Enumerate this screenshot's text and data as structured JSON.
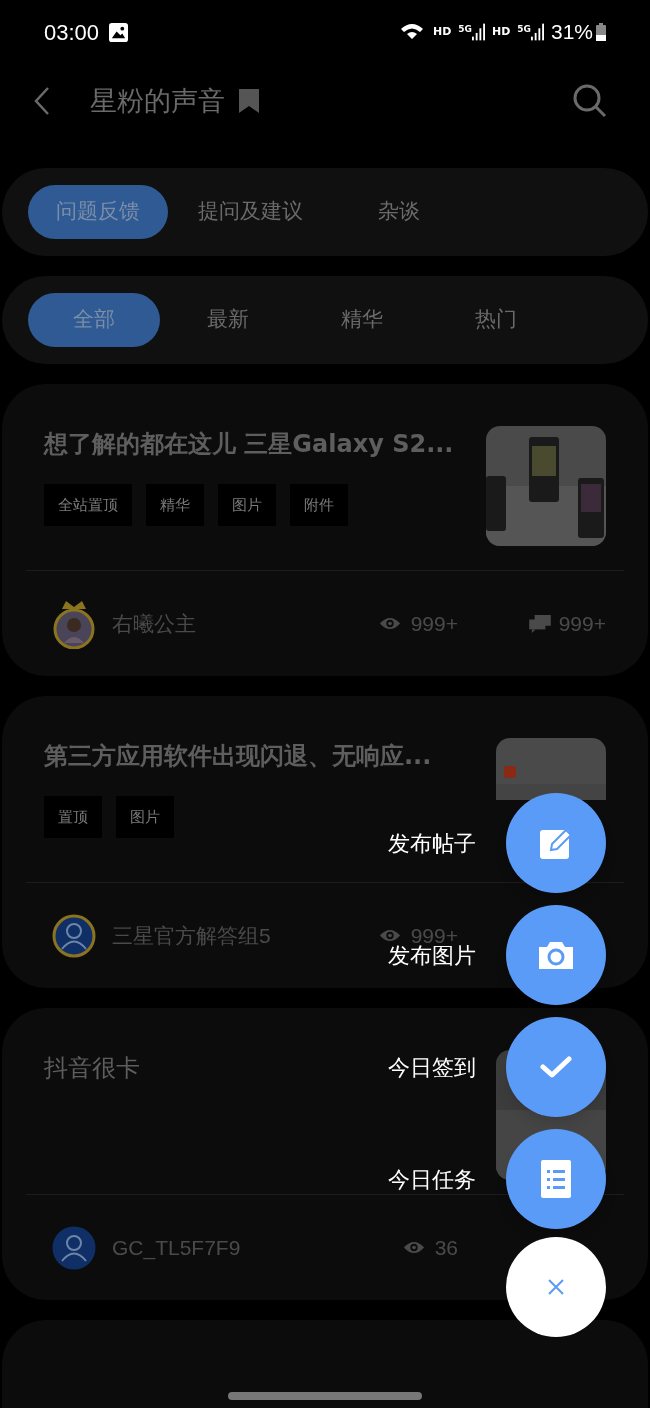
{
  "status_bar": {
    "time": "03:00",
    "indicators": [
      "HD",
      "5G",
      "HD",
      "5G"
    ],
    "battery": "31%"
  },
  "header": {
    "title": "星粉的声音"
  },
  "category_tabs": [
    {
      "label": "问题反馈",
      "selected": true
    },
    {
      "label": "提问及建议",
      "selected": false
    },
    {
      "label": "杂谈",
      "selected": false
    }
  ],
  "filter_tabs": [
    {
      "label": "全部",
      "selected": true
    },
    {
      "label": "最新",
      "selected": false
    },
    {
      "label": "精华",
      "selected": false
    },
    {
      "label": "热门",
      "selected": false
    }
  ],
  "posts": [
    {
      "title": "想了解的都在这儿 三星Galaxy S2...",
      "bold": true,
      "tags": [
        "全站置顶",
        "精华",
        "图片",
        "附件"
      ],
      "thumbnail": {
        "kind": "picture"
      },
      "author": "右曦公主",
      "avatar": {
        "kind": "crown"
      },
      "views": "999+",
      "comments": "999+"
    },
    {
      "title": "第三方应用软件出现闪退、无响应...",
      "bold": true,
      "tags": [
        "置顶",
        "图片"
      ],
      "thumbnail": {
        "kind": "picture"
      },
      "author": "三星官方解答组5",
      "avatar": {
        "kind": "ring"
      },
      "views": "999+"
    },
    {
      "title": "抖音很卡",
      "bold": false,
      "thumbnail": {
        "kind": "picture"
      },
      "author": "GC_TL5F7F9",
      "avatar": {
        "kind": "plain"
      },
      "views": "36"
    }
  ],
  "fab_menu": [
    {
      "label": "发布帖子",
      "kind": "post"
    },
    {
      "label": "发布图片"
    },
    {
      "label": "今日签到",
      "kind": "checkin"
    },
    {
      "label": "今日任务",
      "kind": "tasks"
    }
  ]
}
